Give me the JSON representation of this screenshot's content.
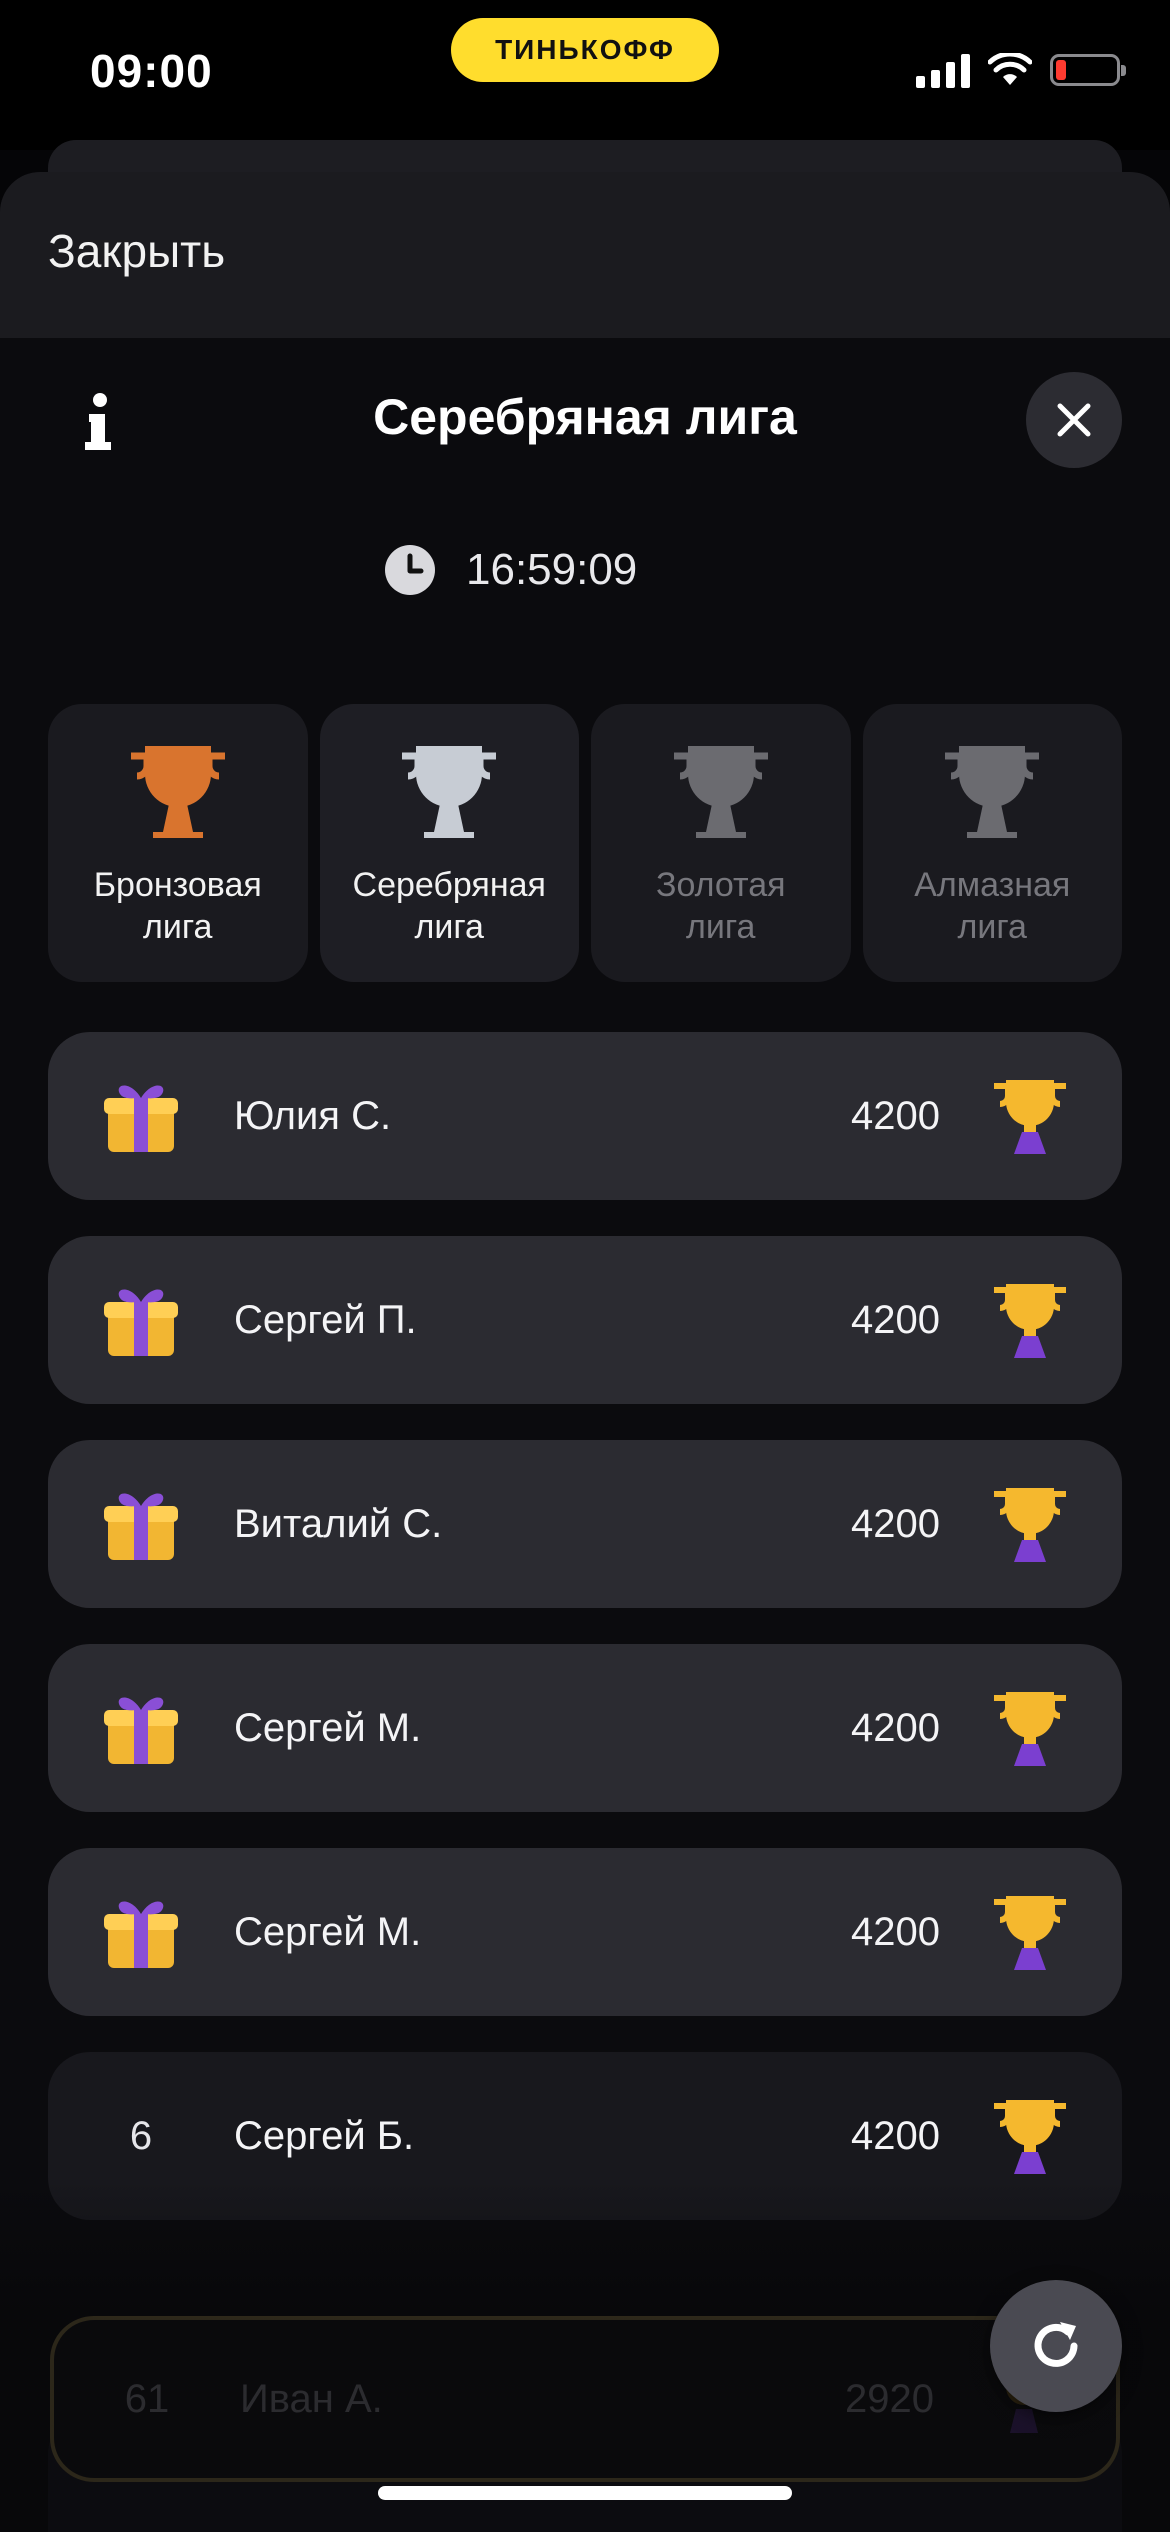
{
  "status_bar": {
    "time": "09:00",
    "brand": "ТИНЬКОФФ"
  },
  "sheet": {
    "close_label": "Закрыть"
  },
  "header": {
    "title": "Серебряная лига",
    "timer": "16:59:09"
  },
  "leagues": [
    {
      "name_line1": "Бронзовая",
      "name_line2": "лига",
      "state": "unlocked",
      "color": "#d9742e"
    },
    {
      "name_line1": "Серебряная",
      "name_line2": "лига",
      "state": "active",
      "color": "#c7ccd4"
    },
    {
      "name_line1": "Золотая",
      "name_line2": "лига",
      "state": "locked",
      "color": "#6b6b70"
    },
    {
      "name_line1": "Алмазная",
      "name_line2": "лига",
      "state": "locked",
      "color": "#6b6b70"
    }
  ],
  "leaderboard": [
    {
      "rank": "",
      "reward": "gift-icon",
      "name": "Юлия С.",
      "score": "4200"
    },
    {
      "rank": "",
      "reward": "gift-icon",
      "name": "Сергей П.",
      "score": "4200"
    },
    {
      "rank": "",
      "reward": "gift-icon",
      "name": "Виталий С.",
      "score": "4200"
    },
    {
      "rank": "",
      "reward": "gift-icon",
      "name": "Сергей М.",
      "score": "4200"
    },
    {
      "rank": "",
      "reward": "gift-icon",
      "name": "Сергей М.",
      "score": "4200"
    },
    {
      "rank": "6",
      "reward": "",
      "name": "Сергей Б.",
      "score": "4200"
    }
  ],
  "current_user": {
    "rank": "61",
    "name": "Иван А.",
    "score": "2920"
  },
  "colors": {
    "brand_yellow": "#ffdd2d",
    "gift_gold": "#f2b632",
    "gift_ribbon": "#8a4fd6",
    "trophy_gold": "#f5b82e",
    "trophy_base": "#7b3fd0"
  }
}
